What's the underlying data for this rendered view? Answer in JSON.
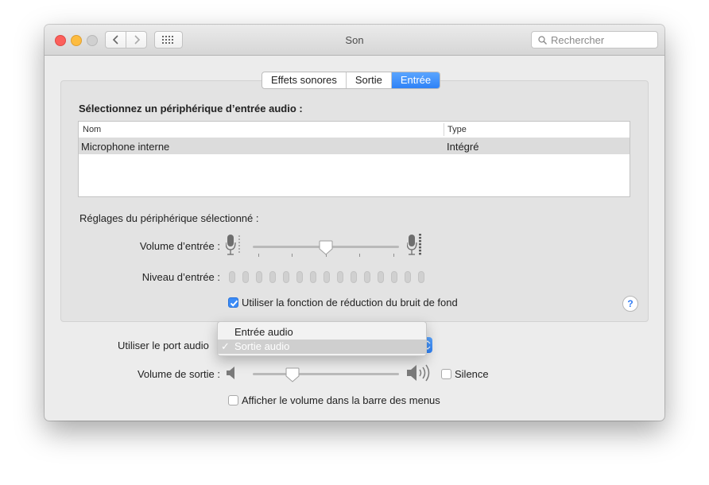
{
  "window": {
    "title": "Son"
  },
  "toolbar": {
    "back_icon": "chevron-left-icon",
    "forward_icon": "chevron-right-icon",
    "grid_icon": "grid-icon",
    "search_placeholder": "Rechercher"
  },
  "tabs": [
    {
      "label": "Effets sonores",
      "active": false
    },
    {
      "label": "Sortie",
      "active": false
    },
    {
      "label": "Entrée",
      "active": true
    }
  ],
  "input": {
    "heading": "Sélectionnez un périphérique d’entrée audio :",
    "columns": [
      "Nom",
      "Type"
    ],
    "rows": [
      {
        "name": "Microphone interne",
        "type": "Intégré",
        "selected": true
      }
    ],
    "settings_heading": "Réglages du périphérique sélectionné :",
    "volume_label": "Volume d’entrée :",
    "volume_level": 0.5,
    "level_label": "Niveau d’entrée :",
    "level_value": 0,
    "level_segments": 15,
    "noise_reduction_label": "Utiliser la fonction de réduction du bruit de fond",
    "noise_reduction_checked": true,
    "help_label": "?"
  },
  "port": {
    "label": "Utiliser le port audio",
    "options": [
      {
        "label": "Entrée audio",
        "selected": false
      },
      {
        "label": "Sortie audio",
        "selected": true
      }
    ],
    "check_mark": "✓"
  },
  "output": {
    "volume_label": "Volume de sortie :",
    "volume_level": 0.27,
    "mute_label": "Silence",
    "mute_checked": false,
    "menubar_label": "Afficher le volume dans la barre des menus",
    "menubar_checked": false
  },
  "colors": {
    "accent": "#2f82f6",
    "close": "#fc605c",
    "minimize": "#fdbc40"
  }
}
